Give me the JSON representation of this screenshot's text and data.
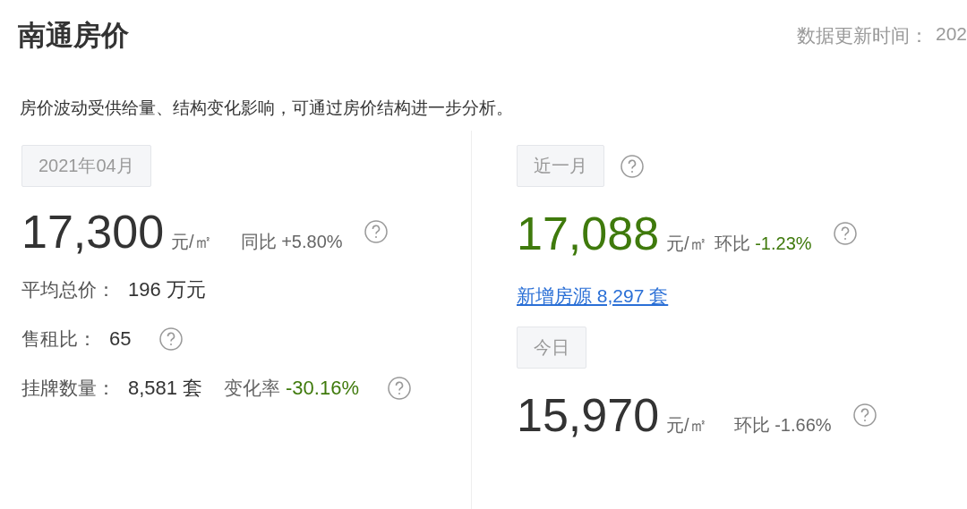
{
  "header": {
    "title": "南通房价",
    "update_label": "数据更新时间：",
    "update_value": "202"
  },
  "description": "房价波动受供给量、结构变化影响，可通过房价结构进一步分析。",
  "monthly": {
    "period": "2021年04月",
    "price": "17,300",
    "unit": "元/㎡",
    "change_label": "同比",
    "change_value": "+5.80%",
    "change_highlighted": false,
    "stats": [
      {
        "label": "平均总价：",
        "value": "196 万元",
        "help": false
      },
      {
        "label": "售租比：",
        "value": "65",
        "help": true
      },
      {
        "label": "挂牌数量：",
        "value": "8,581 套",
        "extra_label": "变化率",
        "extra_value": "-30.16%",
        "extra_highlighted": true,
        "help": true
      }
    ]
  },
  "panels": [
    {
      "period": "近一月",
      "period_help": true,
      "price": "17,088",
      "price_highlighted": true,
      "unit": "元/㎡",
      "change_label": "环比",
      "change_value": "-1.23%",
      "change_highlighted": true,
      "link": "新增房源 8,297 套"
    },
    {
      "period": "今日",
      "period_help": false,
      "price": "15,970",
      "price_highlighted": false,
      "unit": "元/㎡",
      "change_label": "环比",
      "change_value": "-1.66%",
      "change_highlighted": false
    }
  ]
}
